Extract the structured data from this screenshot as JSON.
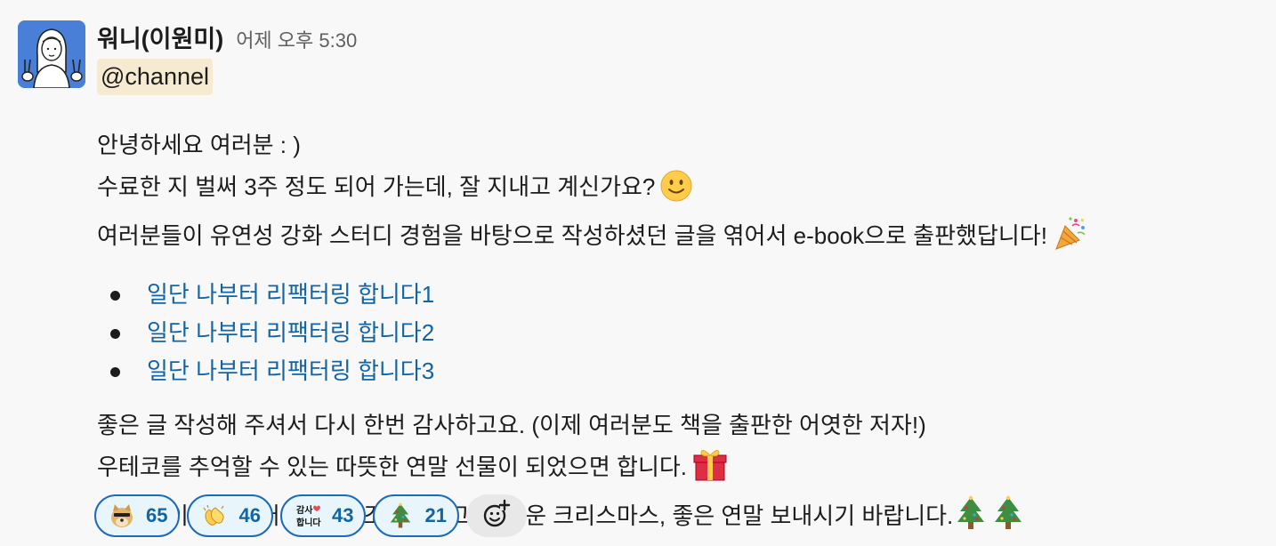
{
  "message": {
    "author": "워니(이원미)",
    "timestamp": "어제 오후 5:30",
    "mention": "@channel",
    "paragraph1": [
      "안녕하세요 여러분 : )",
      "수료한 지 벌써 3주 정도 되어 가는데, 잘 지내고 계신가요?",
      "여러분들이 유연성 강화 스터디 경험을 바탕으로 작성하셨던 글을 엮어서 e-book으로 출판했답니다!"
    ],
    "links": [
      "일단 나부터 리팩터링 합니다1",
      "일단 나부터 리팩터링 합니다2",
      "일단 나부터 리팩터링 합니다3"
    ],
    "paragraph2": [
      "좋은 글 작성해 주셔서 다시 한번 감사하고요. (이제 여러분도 책을 출판한 어엿한 저자!)",
      "우테코를 추억할 수 있는 따뜻한 연말 선물이 되었으면 합니다.",
      "날이 많이 추워졌어요. 감기 조심하시고, 즐거운 크리스마스, 좋은 연말 보내시기 바랍니다."
    ],
    "inline_emojis": [
      "slightly-smiling-face",
      "party-popper",
      "wrapped-gift",
      "christmas-tree",
      "christmas-tree"
    ]
  },
  "reactions": [
    {
      "emoji": "doge-sunglasses",
      "count": "65"
    },
    {
      "emoji": "clapping-hands",
      "count": "46"
    },
    {
      "emoji": "thanks-custom",
      "label": "감사합니다",
      "count": "43"
    },
    {
      "emoji": "christmas-tree",
      "count": "21"
    }
  ],
  "add_reaction_icon": "add-emoji-icon",
  "colors": {
    "link": "#1264a3",
    "mention_bg": "#f6ebd0",
    "reaction_border": "#1d6bb8",
    "reaction_bg": "#e8f5fa",
    "avatar_bg": "#4a7fd8"
  }
}
